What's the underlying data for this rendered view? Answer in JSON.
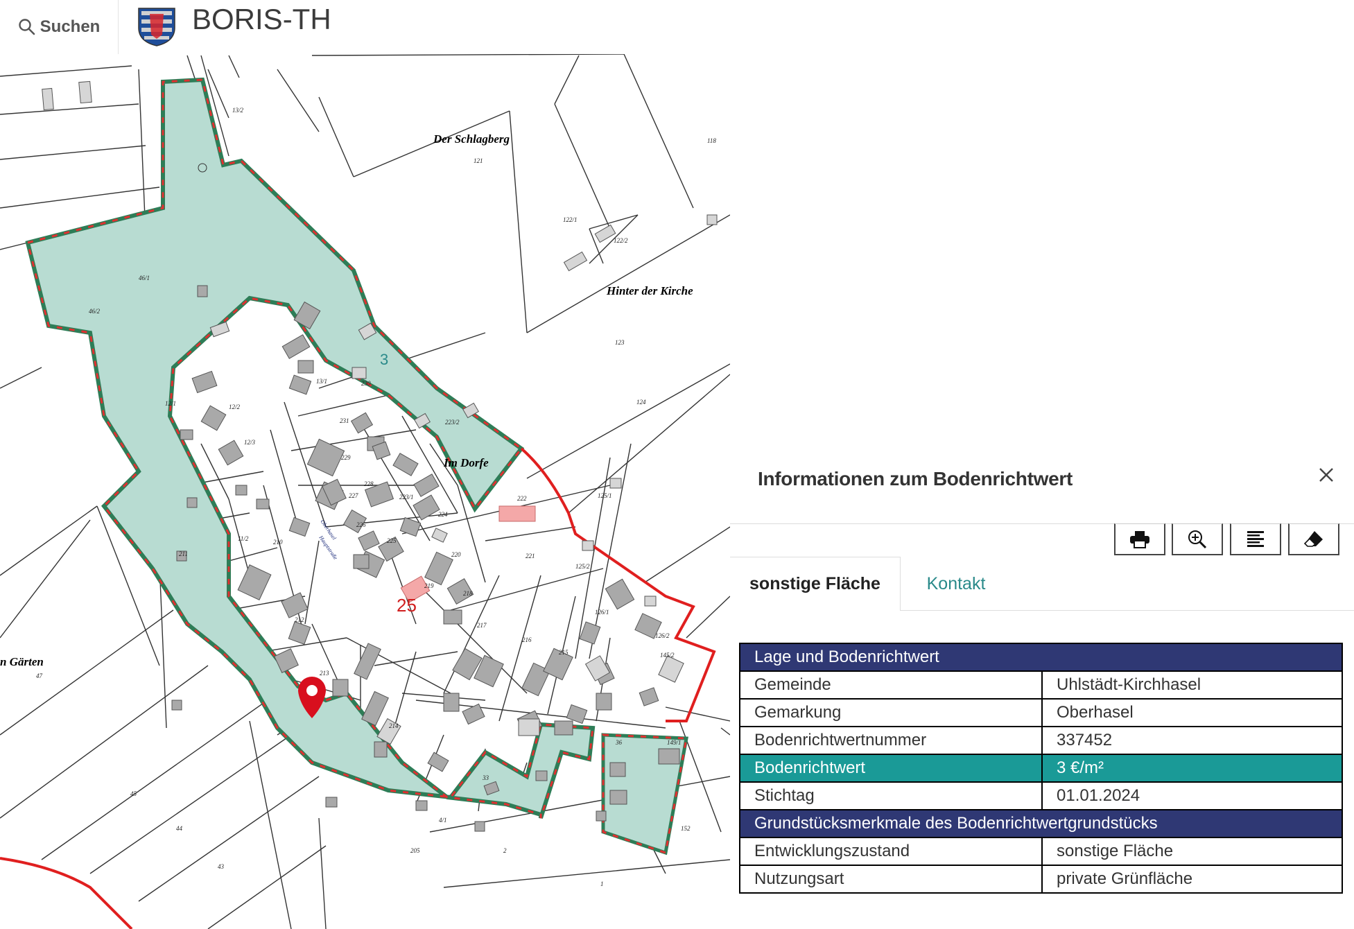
{
  "header": {
    "search_label": "Suchen",
    "app_title": "BORIS-TH",
    "logo": "thuringia-coat-of-arms"
  },
  "map": {
    "zone_labels": [
      "3",
      "25"
    ],
    "area_labels": [
      "Der Schlagberg",
      "Hinter der Kirche",
      "Im Dorfe",
      "n Gärten"
    ],
    "street_labels": [
      "Oberhasel",
      "Hauptstraße"
    ],
    "parcel_numbers": [
      "121",
      "118",
      "122/1",
      "122/2",
      "123",
      "124",
      "125/1",
      "125/2",
      "126/1",
      "126/2",
      "145/2",
      "149/1",
      "152",
      "46/1",
      "46/2",
      "47",
      "45",
      "44",
      "43",
      "211",
      "210",
      "212",
      "213",
      "214",
      "215",
      "216",
      "217",
      "218",
      "219",
      "220",
      "221",
      "222",
      "223/1",
      "223/2",
      "224",
      "225",
      "226",
      "227",
      "228",
      "229",
      "230",
      "231",
      "205",
      "1",
      "2",
      "4/1",
      "36",
      "33",
      "12/1",
      "12/2",
      "12/3",
      "13/2",
      "13/1",
      "11/2"
    ],
    "marker": "location-pin-icon",
    "colors": {
      "zone_fill": "#b8dcd2",
      "zone_border_green": "#2e7d57",
      "zone_border_red": "#e03030",
      "boundary_red": "#e01f1f",
      "building": "#a9a9a9",
      "highlight_building": "#f4a8a8"
    }
  },
  "panel": {
    "title": "Informationen zum Bodenrichtwert",
    "close_icon": "close-icon",
    "toolbar": [
      "print-icon",
      "zoom-in-icon",
      "list-icon",
      "eraser-icon"
    ],
    "tabs": [
      {
        "label": "sonstige Fläche",
        "active": true
      },
      {
        "label": "Kontakt",
        "active": false
      }
    ],
    "section1": "Lage und Bodenrichtwert",
    "rows1": [
      {
        "label": "Gemeinde",
        "value": "Uhlstädt-Kirchhasel"
      },
      {
        "label": "Gemarkung",
        "value": "Oberhasel"
      },
      {
        "label": "Bodenrichtwertnummer",
        "value": "337452"
      },
      {
        "label": "Bodenrichtwert",
        "value": "3 €/m²"
      },
      {
        "label": "Stichtag",
        "value": "01.01.2024"
      }
    ],
    "section2": "Grundstücksmerkmale des Bodenrichtwertgrundstücks",
    "rows2": [
      {
        "label": "Entwicklungszustand",
        "value": "sonstige Fläche"
      },
      {
        "label": "Nutzungsart",
        "value": "private Grünfläche"
      }
    ],
    "colors": {
      "section_header": "#2f3874",
      "highlight_row": "#1a9a97",
      "tab_link": "#2a8a8a"
    }
  }
}
